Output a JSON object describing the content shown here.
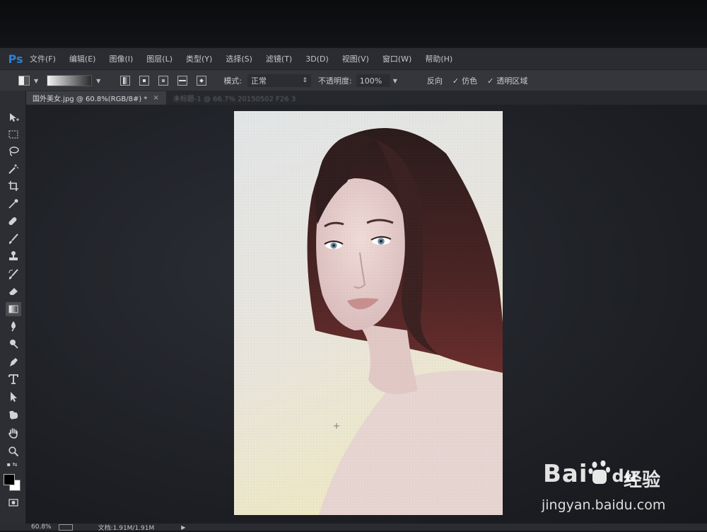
{
  "app": {
    "logo_text": "Ps",
    "menu": [
      "文件(F)",
      "编辑(E)",
      "图像(I)",
      "图层(L)",
      "类型(Y)",
      "选择(S)",
      "滤镜(T)",
      "3D(D)",
      "视图(V)",
      "窗口(W)",
      "帮助(H)"
    ]
  },
  "options": {
    "mode_label": "模式:",
    "mode_value": "正常",
    "opacity_label": "不透明度:",
    "opacity_value": "100%",
    "reverse_label": "反向",
    "dither_label": "仿色",
    "transparency_label": "透明区域"
  },
  "tabs": [
    {
      "label": "国外美女.jpg @ 60.8%(RGB/8#) *",
      "close": "×",
      "active": true
    },
    {
      "label": "未标题-1 @ 66.7% 20150502 F26 3",
      "active": false
    }
  ],
  "tools": [
    "move-icon",
    "marquee-icon",
    "lasso-icon",
    "magic-wand-icon",
    "crop-icon",
    "eyedropper-icon",
    "healing-icon",
    "brush-icon",
    "stamp-icon",
    "history-brush-icon",
    "eraser-icon",
    "gradient-icon",
    "blur-icon",
    "dodge-icon",
    "pen-icon",
    "type-icon",
    "path-select-icon",
    "shape-icon",
    "hand-icon",
    "zoom-icon"
  ],
  "status": {
    "zoom": "60.8%",
    "doc_info": "文档:1.91M/1.91M"
  },
  "watermark": {
    "logo": "Bai",
    "logo_tail": "du",
    "cn": "经验",
    "url": "jingyan.baidu.com"
  },
  "colors": {
    "accent": "#2f7fd6",
    "foreground": "#000000",
    "background": "#ffffff"
  }
}
